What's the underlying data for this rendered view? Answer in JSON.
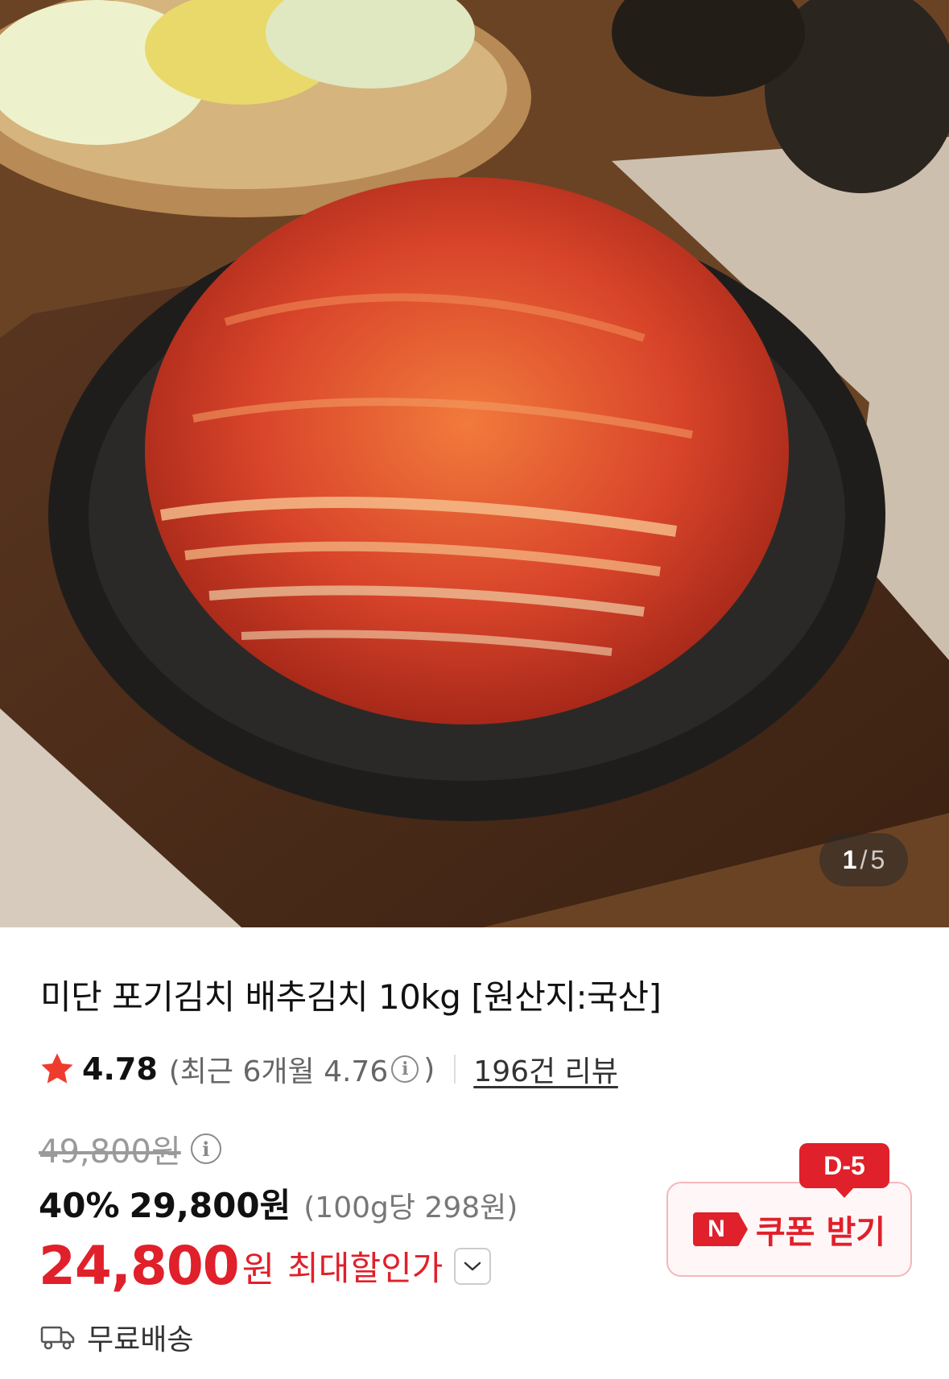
{
  "gallery": {
    "current": "1",
    "separator": "/",
    "total": "5"
  },
  "product": {
    "title": "미단 포기김치 배추김치 10kg [원산지:국산]"
  },
  "rating": {
    "score": "4.78",
    "recent_prefix": "(최근 6개월 4.76",
    "info_glyph": "i",
    "recent_suffix": ")",
    "review_count": "196건 리뷰"
  },
  "price": {
    "original": "49,800원",
    "discount_percent": "40%",
    "sale_price": "29,800원",
    "unit_price": "(100g당 298원)",
    "max_discount_price": "24,800",
    "max_discount_unit": "원",
    "max_discount_label": "최대할인가"
  },
  "coupon": {
    "badge": "D-5",
    "brand_letter": "N",
    "label": "쿠폰 받기"
  },
  "shipping": {
    "label": "무료배송"
  },
  "colors": {
    "accent_red": "#e0202a",
    "star": "#ef3b2d"
  }
}
